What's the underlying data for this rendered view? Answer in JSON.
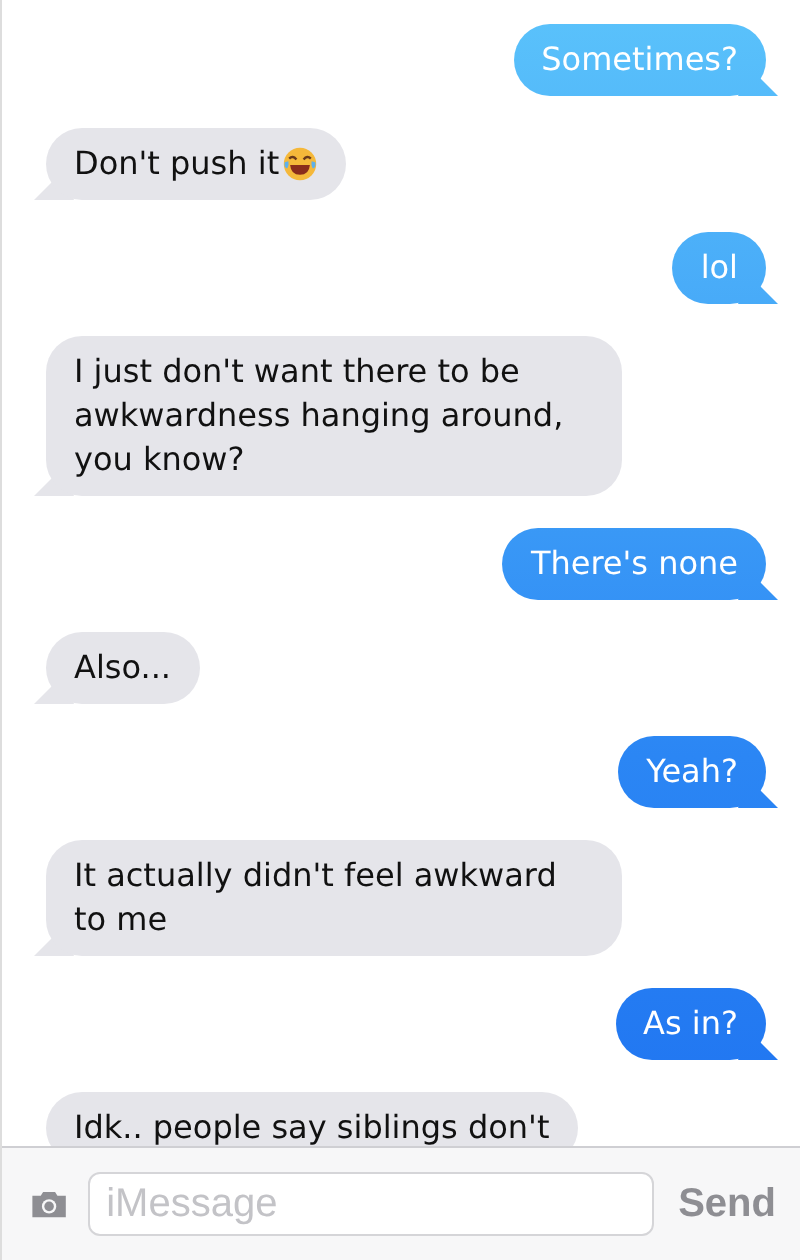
{
  "messages": [
    {
      "text": "Sometimes?",
      "kind": "sent",
      "emoji": false
    },
    {
      "text": "Don't push it",
      "kind": "received",
      "emoji": true
    },
    {
      "text": "lol",
      "kind": "sent",
      "emoji": false
    },
    {
      "text": "I just don't want there to be awkwardness hanging around, you know?",
      "kind": "received",
      "emoji": false
    },
    {
      "text": "There's none",
      "kind": "sent",
      "emoji": false
    },
    {
      "text": "Also...",
      "kind": "received",
      "emoji": false
    },
    {
      "text": "Yeah?",
      "kind": "sent",
      "emoji": false
    },
    {
      "text": "It actually didn't feel awkward to me",
      "kind": "received",
      "emoji": false
    },
    {
      "text": "As in?",
      "kind": "sent",
      "emoji": false
    },
    {
      "text": "Idk.. people say siblings don't",
      "kind": "received",
      "emoji": false
    }
  ],
  "composer": {
    "placeholder": "iMessage",
    "send_label": "Send",
    "send_disabled": true
  }
}
